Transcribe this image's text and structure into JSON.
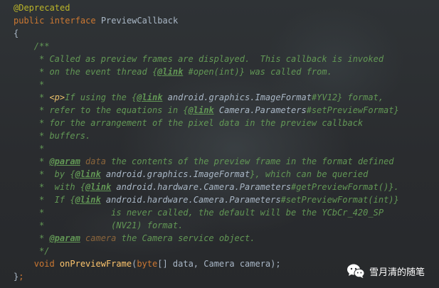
{
  "code_lines": [
    {
      "indent": 0,
      "tokens": [
        {
          "t": "@Deprecated",
          "c": "annot"
        }
      ]
    },
    {
      "indent": 0,
      "tokens": [
        {
          "t": "public interface ",
          "c": "kw"
        },
        {
          "t": "PreviewCallback",
          "c": "plain"
        }
      ]
    },
    {
      "indent": 0,
      "tokens": [
        {
          "t": "{",
          "c": "plain"
        }
      ]
    },
    {
      "indent": 1,
      "tokens": [
        {
          "t": "/**",
          "c": "doc"
        }
      ]
    },
    {
      "indent": 2,
      "tokens": [
        {
          "t": "* Called as preview frames are displayed.  This callback is invoked",
          "c": "doc"
        }
      ]
    },
    {
      "indent": 2,
      "tokens": [
        {
          "t": "* on the event thread {",
          "c": "doc"
        },
        {
          "t": "@link",
          "c": "doctag"
        },
        {
          "t": " #open(int)",
          "c": "doc"
        },
        {
          "t": "} was called from.",
          "c": "doc"
        }
      ]
    },
    {
      "indent": 2,
      "tokens": [
        {
          "t": "*",
          "c": "doc"
        }
      ]
    },
    {
      "indent": 2,
      "tokens": [
        {
          "t": "* ",
          "c": "doc"
        },
        {
          "t": "<p>",
          "c": "html"
        },
        {
          "t": "If using the {",
          "c": "doc"
        },
        {
          "t": "@link",
          "c": "doctag"
        },
        {
          "t": " android.graphics.ImageFormat",
          "c": "ref"
        },
        {
          "t": "#YV12} format,",
          "c": "doc"
        }
      ]
    },
    {
      "indent": 2,
      "tokens": [
        {
          "t": "* refer to the equations in {",
          "c": "doc"
        },
        {
          "t": "@link",
          "c": "doctag"
        },
        {
          "t": " Camera.Parameters",
          "c": "ref"
        },
        {
          "t": "#setPreviewFormat}",
          "c": "doc"
        }
      ]
    },
    {
      "indent": 2,
      "tokens": [
        {
          "t": "* for the arrangement of the pixel data in the preview callback",
          "c": "doc"
        }
      ]
    },
    {
      "indent": 2,
      "tokens": [
        {
          "t": "* buffers.",
          "c": "doc"
        }
      ]
    },
    {
      "indent": 2,
      "tokens": [
        {
          "t": "*",
          "c": "doc"
        }
      ]
    },
    {
      "indent": 2,
      "tokens": [
        {
          "t": "* ",
          "c": "doc"
        },
        {
          "t": "@param",
          "c": "doctag"
        },
        {
          "t": " data",
          "c": "param"
        },
        {
          "t": " the contents of the preview frame in the format defined",
          "c": "doc"
        }
      ]
    },
    {
      "indent": 2,
      "tokens": [
        {
          "t": "*  by {",
          "c": "doc"
        },
        {
          "t": "@link",
          "c": "doctag"
        },
        {
          "t": " android.graphics.ImageFormat",
          "c": "ref"
        },
        {
          "t": "}, which can be queried",
          "c": "doc"
        }
      ]
    },
    {
      "indent": 2,
      "tokens": [
        {
          "t": "*  with {",
          "c": "doc"
        },
        {
          "t": "@link",
          "c": "doctag"
        },
        {
          "t": " android.hardware.Camera.Parameters",
          "c": "ref"
        },
        {
          "t": "#getPreviewFormat()}.",
          "c": "doc"
        }
      ]
    },
    {
      "indent": 2,
      "tokens": [
        {
          "t": "*  If {",
          "c": "doc"
        },
        {
          "t": "@link",
          "c": "doctag"
        },
        {
          "t": " android.hardware.Camera.Parameters",
          "c": "ref"
        },
        {
          "t": "#setPreviewFormat(int)}",
          "c": "doc"
        }
      ]
    },
    {
      "indent": 2,
      "tokens": [
        {
          "t": "*             is never called, the default will be the YCbCr_420_SP",
          "c": "doc"
        }
      ]
    },
    {
      "indent": 2,
      "tokens": [
        {
          "t": "*             (NV21) format.",
          "c": "doc"
        }
      ]
    },
    {
      "indent": 2,
      "tokens": [
        {
          "t": "* ",
          "c": "doc"
        },
        {
          "t": "@param",
          "c": "doctag"
        },
        {
          "t": " camera",
          "c": "param"
        },
        {
          "t": " the Camera service object.",
          "c": "doc"
        }
      ]
    },
    {
      "indent": 2,
      "tokens": [
        {
          "t": "*/",
          "c": "doc"
        }
      ]
    },
    {
      "indent": 1,
      "tokens": [
        {
          "t": "void ",
          "c": "kw"
        },
        {
          "t": "onPreviewFrame",
          "c": "fn"
        },
        {
          "t": "(",
          "c": "plain"
        },
        {
          "t": "byte",
          "c": "kw"
        },
        {
          "t": "[] data, Camera camera);",
          "c": "plain"
        }
      ]
    },
    {
      "indent": 0,
      "tokens": [
        {
          "t": "}",
          "c": "plain"
        },
        {
          "t": ";",
          "c": "kw"
        }
      ]
    }
  ],
  "watermark": {
    "icon": "wechat-icon",
    "text": "雪月清的随笔"
  }
}
